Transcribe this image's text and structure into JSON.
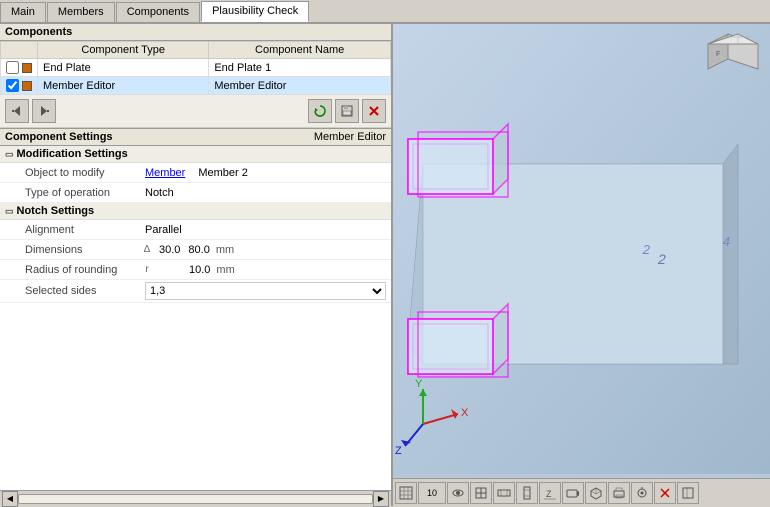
{
  "tabs": [
    {
      "label": "Main",
      "active": false
    },
    {
      "label": "Members",
      "active": false
    },
    {
      "label": "Components",
      "active": false
    },
    {
      "label": "Plausibility Check",
      "active": true
    }
  ],
  "components_section": {
    "title": "Components",
    "columns": [
      "Component Type",
      "Component Name"
    ],
    "rows": [
      {
        "checked": false,
        "color": "#cc6600",
        "type": "End Plate",
        "name": "End Plate 1",
        "selected": false
      },
      {
        "checked": true,
        "color": "#cc6600",
        "type": "Member Editor",
        "name": "Member Editor",
        "selected": true
      }
    ]
  },
  "toolbar": {
    "btn1": "⬅",
    "btn2": "➡",
    "btn3": "🔄",
    "btn4": "💾",
    "btn_delete": "✕"
  },
  "settings": {
    "title": "Component Settings",
    "subtitle": "Member Editor",
    "groups": [
      {
        "name": "Modification Settings",
        "properties": [
          {
            "name": "Object to modify",
            "icon": "",
            "value": "Member",
            "value2": "Member 2",
            "link": true
          },
          {
            "name": "Type of operation",
            "icon": "",
            "value": "Notch",
            "value2": "",
            "link": false
          }
        ]
      },
      {
        "name": "Notch Settings",
        "properties": [
          {
            "name": "Alignment",
            "icon": "",
            "value": "Parallel",
            "value2": "",
            "link": false
          },
          {
            "name": "Dimensions",
            "icon": "Δ",
            "value": "30.0",
            "value2": "80.0",
            "unit": "mm",
            "link": false
          },
          {
            "name": "Radius of rounding",
            "icon": "r",
            "value": "10.0",
            "unit": "mm",
            "link": false
          },
          {
            "name": "Selected sides",
            "icon": "",
            "value": "1,3",
            "isSelect": true,
            "link": false
          }
        ]
      }
    ]
  },
  "viewport": {
    "labels": [
      "4",
      "2"
    ],
    "axis": {
      "x": "X",
      "y": "Y",
      "z": "Z"
    },
    "toolbar_buttons": [
      "grid",
      "10",
      "eye",
      "fit",
      "fit-h",
      "fit-v",
      "fit-z",
      "cam",
      "box",
      "print",
      "cam2",
      "close",
      "expand"
    ]
  }
}
